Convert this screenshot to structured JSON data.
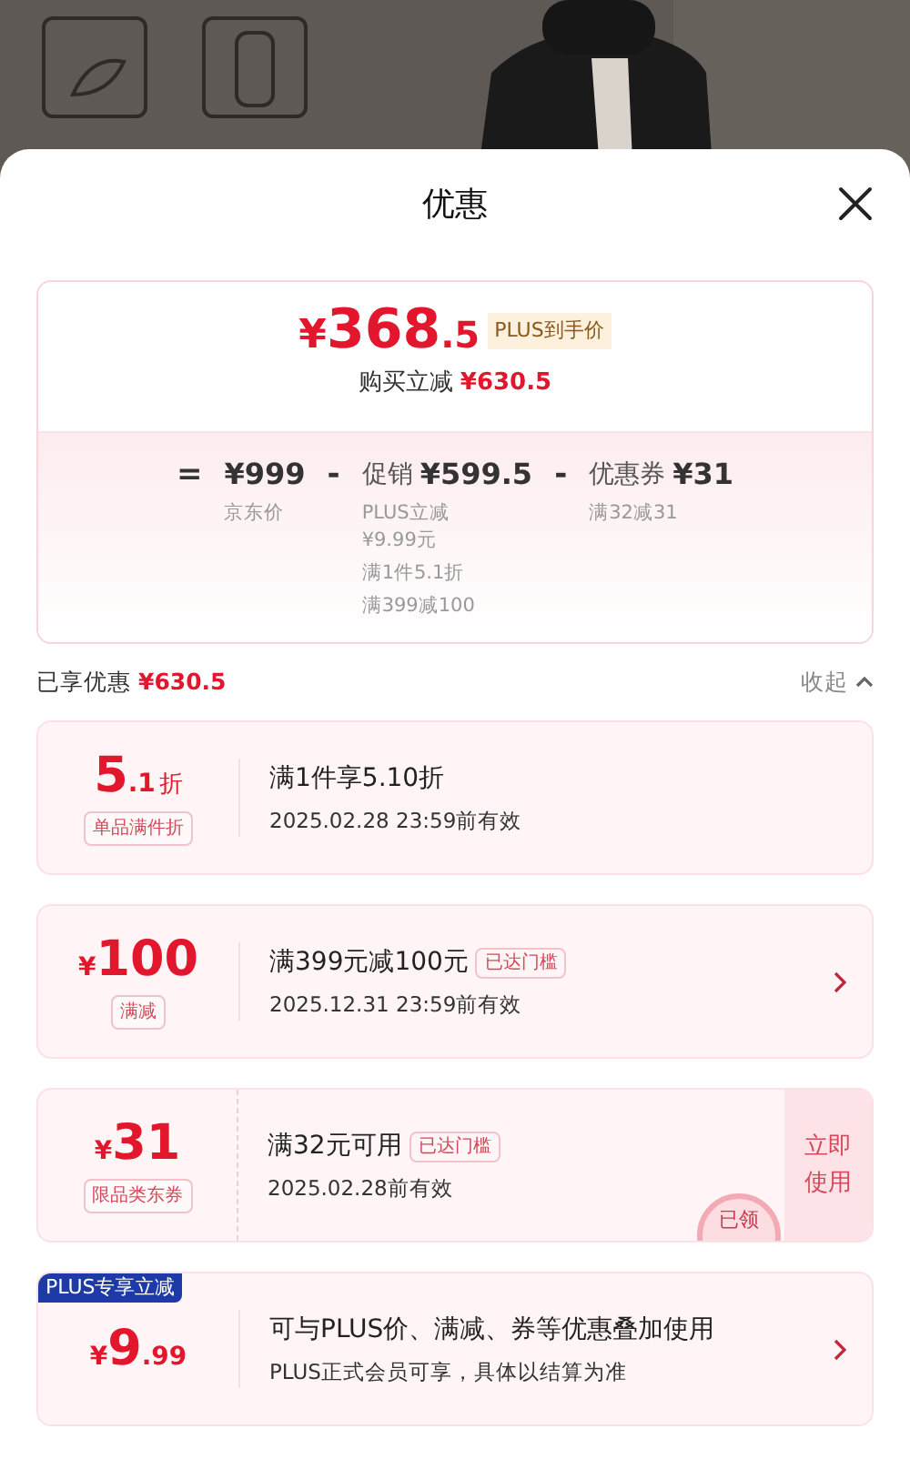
{
  "sheet": {
    "title": "优惠"
  },
  "summary": {
    "currency": "¥",
    "price_main": "368",
    "price_small": ".5",
    "price_tag": "PLUS到手价",
    "saving_label": "购买立减",
    "saving_amount": "¥630.5",
    "breakdown": [
      {
        "kind": "op",
        "text": "="
      },
      {
        "kind": "term",
        "amount": "¥999",
        "notes": [
          "京东价"
        ]
      },
      {
        "kind": "op",
        "text": "-"
      },
      {
        "kind": "term",
        "name": "促销",
        "amount": "¥599.5",
        "notes": [
          "PLUS立减 ¥9.99元",
          "满1件5.1折",
          "满399减100"
        ]
      },
      {
        "kind": "op",
        "text": "-"
      },
      {
        "kind": "term",
        "name": "优惠券",
        "amount": "¥31",
        "notes": [
          "满32减31"
        ]
      }
    ]
  },
  "enjoyed": {
    "label": "已享优惠",
    "amount": "¥630.5",
    "toggle": "收起",
    "expanded": true
  },
  "coupons": [
    {
      "kind": "discount",
      "value_main": "5",
      "value_small": ".1",
      "unit": "折",
      "tag": "单品满件折",
      "title": "满1件享5.10折",
      "expiry": "2025.02.28 23:59前有效",
      "arrow": false
    },
    {
      "kind": "amount",
      "currency": "¥",
      "value_main": "100",
      "tag": "满减",
      "title": "满399元减100元",
      "badge": "已达门槛",
      "expiry": "2025.12.31 23:59前有效",
      "arrow": true
    },
    {
      "kind": "ticket",
      "currency": "¥",
      "value_main": "31",
      "tag": "限品类东券",
      "title": "满32元可用",
      "badge": "已达门槛",
      "expiry": "2025.02.28前有效",
      "action": "立即使用",
      "stamp": "已领",
      "arrow": false
    },
    {
      "kind": "amount",
      "ribbon": "PLUS专享立减",
      "currency": "¥",
      "value_main": "9",
      "value_small": ".99",
      "title": "可与PLUS价、满减、券等优惠叠加使用",
      "expiry": "PLUS正式会员可享，具体以结算为准",
      "arrow": true
    }
  ]
}
